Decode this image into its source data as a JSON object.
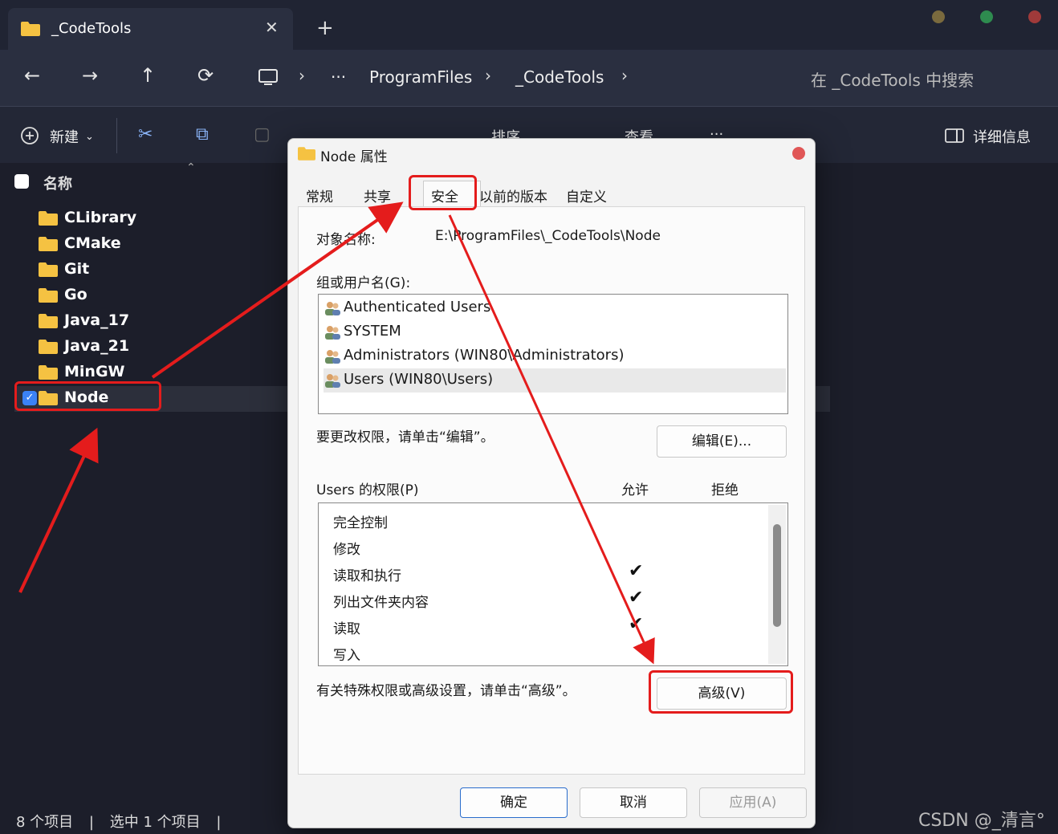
{
  "tab": {
    "title": "_CodeTools",
    "close": "✕",
    "add": "+"
  },
  "window_dots": {
    "c1": "#7a6a3e",
    "c2": "#2e8b4f",
    "c3": "#a03a3a"
  },
  "nav": {
    "back": "←",
    "forward": "→",
    "up": "↑",
    "refresh": "⟳",
    "more": "···",
    "sep": "›",
    "breadcrumbs": [
      "ProgramFiles",
      "_CodeTools"
    ],
    "search_placeholder": "在 _CodeTools 中搜索"
  },
  "toolbar": {
    "new_label": "新建",
    "sort_label": "排序",
    "view_label": "查看",
    "more": "···",
    "details_label": "详细信息"
  },
  "list": {
    "header_name": "名称",
    "items": [
      "CLibrary",
      "CMake",
      "Git",
      "Go",
      "Java_17",
      "Java_21",
      "MinGW",
      "Node"
    ],
    "selected": "Node"
  },
  "status": {
    "count": "8 个项目",
    "selected": "选中 1 个项目"
  },
  "watermark": "CSDN @_清言°",
  "dialog": {
    "title": "Node 属性",
    "tabs": [
      "常规",
      "共享",
      "安全",
      "以前的版本",
      "自定义"
    ],
    "active_tab": "安全",
    "object_label": "对象名称:",
    "object_value": "E:\\ProgramFiles\\_CodeTools\\Node",
    "groups_label": "组或用户名(G):",
    "groups": [
      "Authenticated Users",
      "SYSTEM",
      "Administrators (WIN80\\Administrators)",
      "Users (WIN80\\Users)"
    ],
    "selected_group": "Users (WIN80\\Users)",
    "edit_hint": "要更改权限，请单击“编辑”。",
    "edit_button": "编辑(E)...",
    "perm_label": "Users 的权限(P)",
    "allow_col": "允许",
    "deny_col": "拒绝",
    "permissions": [
      {
        "name": "完全控制",
        "allow": ""
      },
      {
        "name": "修改",
        "allow": ""
      },
      {
        "name": "读取和执行",
        "allow": "✔"
      },
      {
        "name": "列出文件夹内容",
        "allow": "✔"
      },
      {
        "name": "读取",
        "allow": "✔"
      },
      {
        "name": "写入",
        "allow": ""
      }
    ],
    "advanced_hint": "有关特殊权限或高级设置，请单击“高级”。",
    "advanced_button": "高级(V)",
    "ok_button": "确定",
    "cancel_button": "取消",
    "apply_button": "应用(A)"
  },
  "colors": {
    "folder": "#f5c242",
    "annotation": "#e41c1c",
    "accent": "#3b82f6"
  }
}
